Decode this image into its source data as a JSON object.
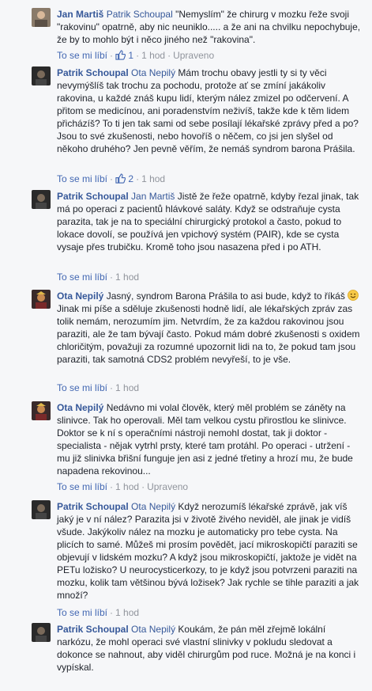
{
  "comments": [
    {
      "author": "Jan Martiš",
      "mention": "Patrik Schoupal",
      "text": "\"Nemyslím\" že chirurg v mozku řeže svoji \"rakovinu\" opatrně, aby nic neuniklo..... a že ani na chvilku nepochybuje, že by to mohlo být i něco jiného než \"rakovina\".",
      "like_label": "To se mi líbí",
      "likes": "1",
      "time": "1 hod",
      "edited": "Upraveno",
      "avatar": "person-photo-icon"
    },
    {
      "author": "Patrik Schoupal",
      "mention": "Ota Nepilý",
      "text": "Mám trochu obavy jestli ty si ty věci nevymýšlíš tak trochu za pochodu, protože ať se zmíní jakákoliv rakovina, u každé znáš kupu lidí, kterým nález zmizel po odčervení. A přitom se medicínou, ani poradenstvím neživíš, takže kde k těm lidem přicházíš? To ti jen tak sami od sebe posílají lékařské zprávy před a po? Jsou to své zkušenosti, nebo hovoříš o něčem, co jsi jen slyšel od někoho druhého? Jen pevně věřím, že nemáš syndrom barona Prášila.",
      "like_label": "To se mi líbí",
      "likes": "2",
      "time": "1 hod",
      "avatar": "person-photo-icon"
    },
    {
      "author": "Patrik Schoupal",
      "mention": "Jan Martiš",
      "text": "Jistě že řeže opatrně, kdyby řezal jinak, tak má po operaci z pacientů hlávkové saláty. Když se odstraňuje cysta parazita, tak je na to speciální chirurgický protokol a často, pokud to lokace dovolí, se používá jen vpichový systém (PAIR), kde se cysta vysaje přes trubičku. Kromě toho jsou nasazena před i po ATH.",
      "like_label": "To se mi líbí",
      "time": "1 hod",
      "avatar": "person-photo-icon"
    },
    {
      "author": "Ota Nepilý",
      "mention": "",
      "text_before_emoji": "Jasný, syndrom Barona Prášila to asi bude, když to říkáš",
      "text": "Jinak mi píše a sděluje zkušenosti hodně lidí, ale lékařských zpráv zas tolik nemám, nerozumím jim. Netvrdím, že za každou rakovinou jsou paraziti, ale že tam bývají často. Pokud mám dobré zkušenosti s oxidem chloričitým, považuji za rozumné upozornit lidi na to, že pokud tam jsou paraziti, tak samotná CDS2 problém nevyřeší, to je vše.",
      "like_label": "To se mi líbí",
      "time": "1 hod",
      "avatar": "person-photo-icon"
    },
    {
      "author": "Ota Nepilý",
      "mention": "",
      "text": "Nedávno mi volal člověk, který měl problém se záněty na slinivce. Tak ho operovali. Měl tam velkou cystu přirostlou ke slinivce. Doktor se k ní s operačními nástroji nemohl dostat, tak ji doktor - specialista - nějak vytrhl prsty, které tam protáhl. Po operaci - utržení - mu již slinivka břišní funguje jen asi z jedné třetiny a hrozí mu, že bude napadena rekovinou...",
      "like_label": "To se mi líbí",
      "time": "1 hod",
      "edited": "Upraveno",
      "avatar": "person-photo-icon"
    },
    {
      "author": "Patrik Schoupal",
      "mention": "Ota Nepilý",
      "text": "Když nerozumíš lékařské zprávě, jak víš jaký je v ní nález? Parazita jsi v životě živého neviděl, ale jinak je vidíš všude. Jakýkoliv nález na mozku je automaticky pro tebe cysta. Na plicích to samé. Můžeš mi prosím povědět, jací mikroskopičtí paraziti se objevují v lidském mozku? A když jsou mikroskopičtí, jaktože je vidět na PETu ložisko? U neurocysticerkozy, to je když jsou potvrzeni paraziti na mozku, kolik tam většinou bývá ložisek? Jak rychle se tihle paraziti a jak množí?",
      "like_label": "To se mi líbí",
      "time": "1 hod",
      "avatar": "person-photo-icon"
    },
    {
      "author": "Patrik Schoupal",
      "mention": "Ota Nepilý",
      "text": "Koukám, že pán měl zřejmě lokální narkózu, že mohl operaci své vlastní slinivky v pokludu sledovat a dokonce se nahnout, aby viděl chirurgům pod ruce. Možná je na konci i vypískal.",
      "avatar": "person-photo-icon"
    }
  ],
  "colors": {
    "link": "#365899",
    "action_link": "#4267b2",
    "meta": "#90949c",
    "text": "#1d2129",
    "background": "#f6f7f9"
  }
}
